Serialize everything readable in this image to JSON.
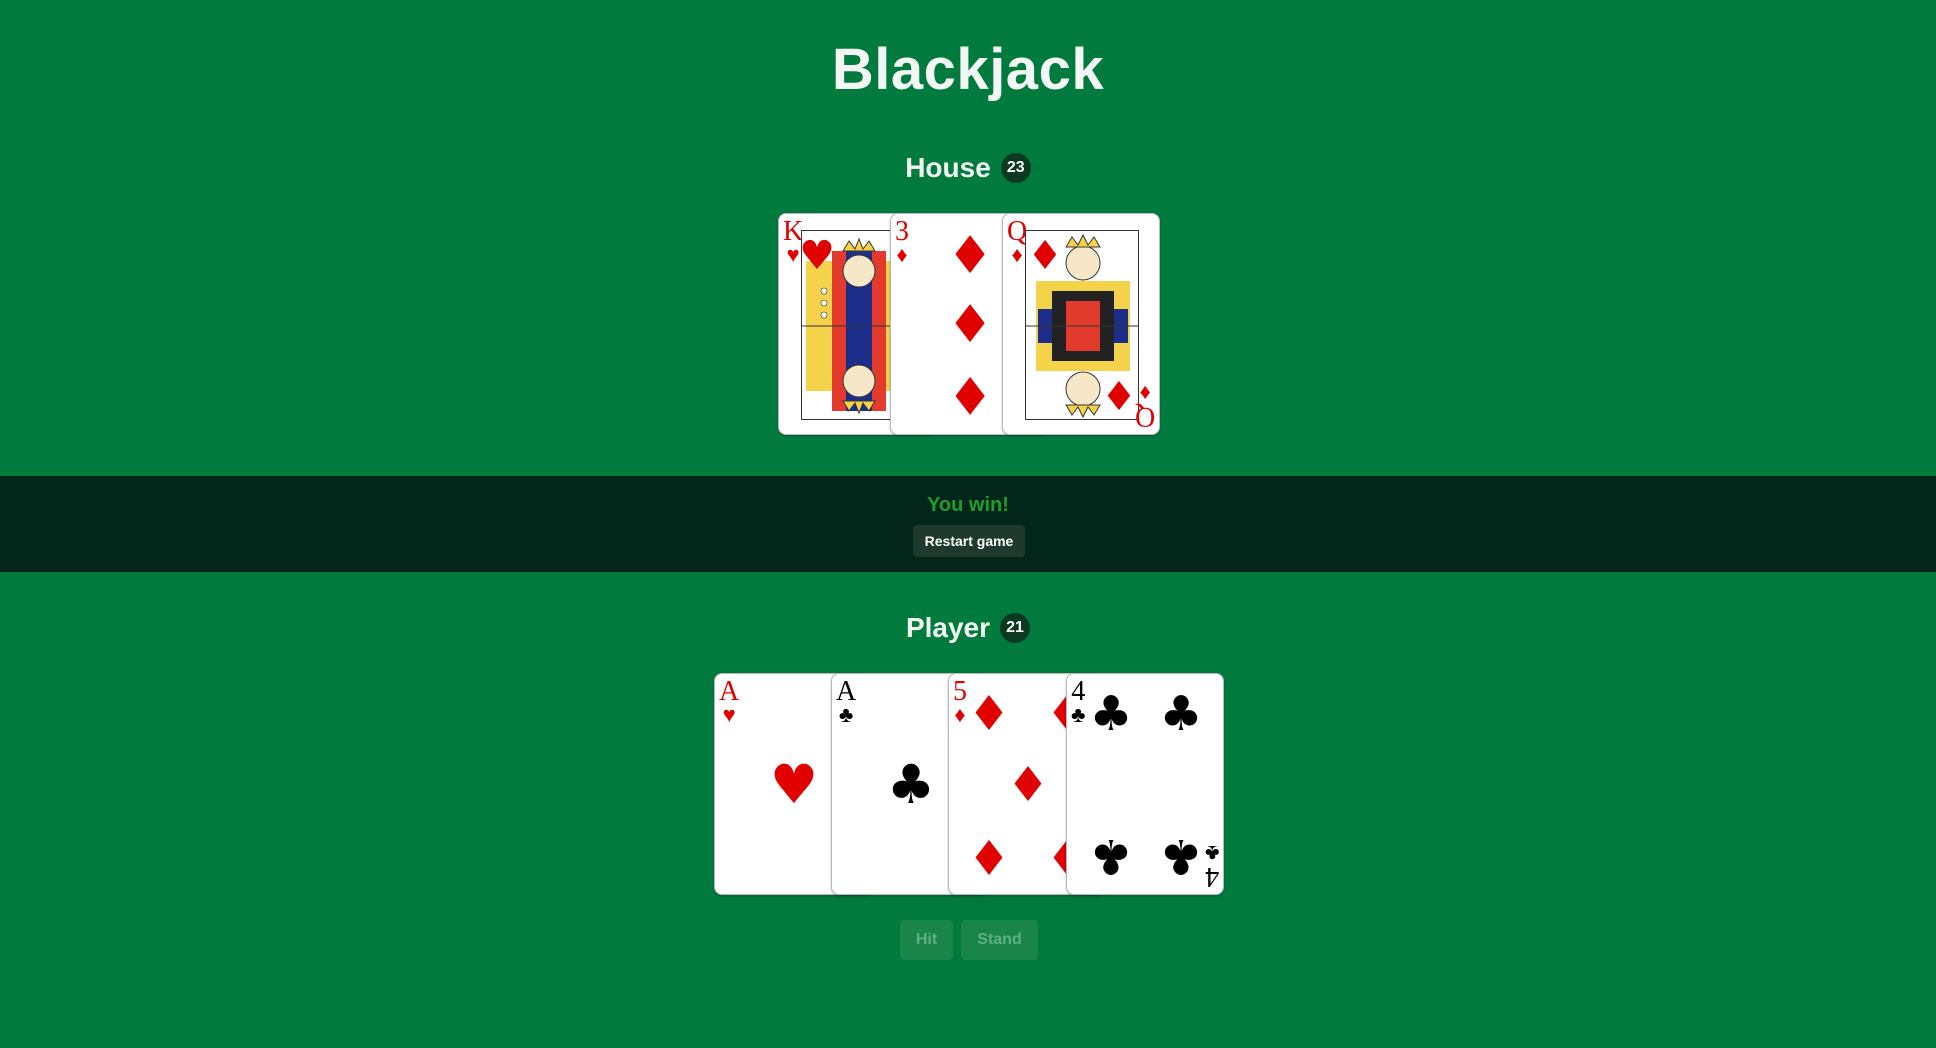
{
  "title": "Blackjack",
  "colors": {
    "table": "#007a3d",
    "band": "#02261a",
    "win_text": "#1f9e2d",
    "red_suit": "#e00000",
    "black_suit": "#000000"
  },
  "house": {
    "label": "House",
    "score": "23",
    "cards": [
      {
        "rank": "K",
        "suit": "♥",
        "suit_name": "hearts",
        "color": "red"
      },
      {
        "rank": "3",
        "suit": "♦",
        "suit_name": "diamonds",
        "color": "red"
      },
      {
        "rank": "Q",
        "suit": "♦",
        "suit_name": "diamonds",
        "color": "red"
      }
    ]
  },
  "result": {
    "message": "You win!",
    "restart_label": "Restart game"
  },
  "player": {
    "label": "Player",
    "score": "21",
    "cards": [
      {
        "rank": "A",
        "suit": "♥",
        "suit_name": "hearts",
        "color": "red"
      },
      {
        "rank": "A",
        "suit": "♣",
        "suit_name": "clubs",
        "color": "black"
      },
      {
        "rank": "5",
        "suit": "♦",
        "suit_name": "diamonds",
        "color": "red"
      },
      {
        "rank": "4",
        "suit": "♣",
        "suit_name": "clubs",
        "color": "black"
      }
    ]
  },
  "actions": {
    "hit_label": "Hit",
    "stand_label": "Stand",
    "disabled": true
  }
}
